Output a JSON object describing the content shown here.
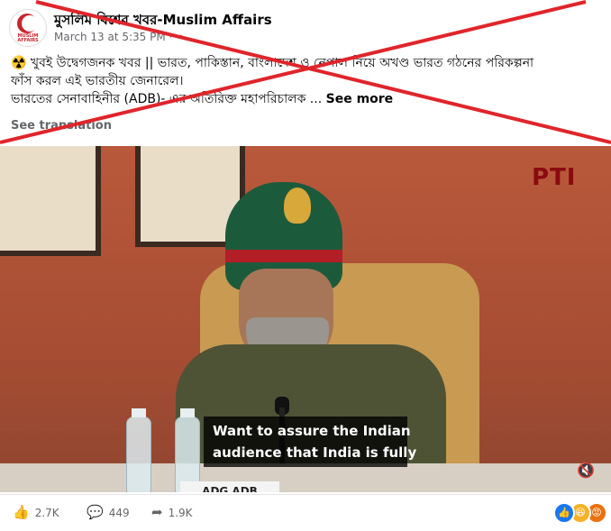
{
  "header": {
    "page_name": "মুসলিম বিশ্বের খবর-Muslim Affairs",
    "avatar_text": "MUSLIM AFFAIRS",
    "timestamp": "March 13 at 5:35 PM",
    "privacy_icon": "globe-icon"
  },
  "post": {
    "line1": "☢️ খুবই উদ্বেগজনক খবর || ভারত, পাকিস্তান, বাংলাদেশ ও নেপাল নিয়ে অখণ্ড ভারত গঠনের পরিকল্পনা",
    "line2": "ফাঁস করল এই ভারতীয় জেনারেল।",
    "line3": "ভারতের সেনাবাহিনীর (ADB)- এর অতিরিক্ত মহাপরিচালক ...",
    "see_more": "See more",
    "see_translation": "See translation"
  },
  "video": {
    "watermark": "PTI",
    "caption_line1": "Want to assure the Indian",
    "caption_line2": "audience that India is fully",
    "nameplate": "ADG ADB",
    "mute_icon": "speaker-muted-icon"
  },
  "actions": {
    "likes": "2.7K",
    "comments": "449",
    "shares": "1.9K",
    "reactions": [
      "like-icon",
      "haha-icon",
      "angry-icon"
    ]
  },
  "colors": {
    "strike": "#e0252b",
    "muted_text": "#65676b",
    "brand": "#c9252c"
  }
}
